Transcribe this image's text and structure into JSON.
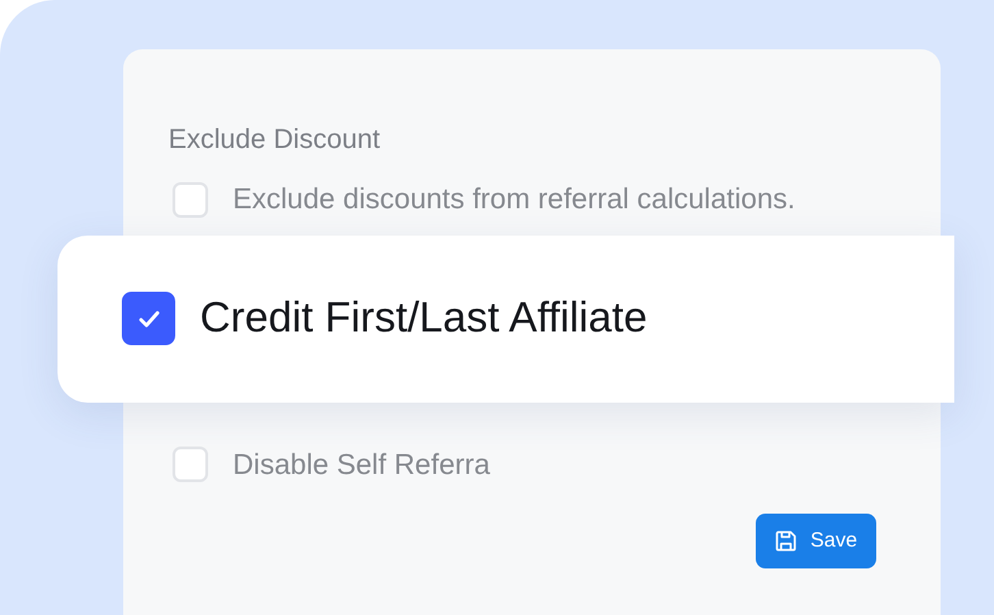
{
  "section": {
    "title": "Exclude Discount"
  },
  "options": [
    {
      "kind": "plain",
      "label": "Exclude discounts from referral calculations.",
      "checked": false
    },
    {
      "kind": "featured",
      "label": "Credit First/Last Affiliate",
      "checked": true
    },
    {
      "kind": "plain",
      "label": "Disable Self Referra",
      "checked": false
    }
  ],
  "save_button": {
    "label": "Save"
  }
}
